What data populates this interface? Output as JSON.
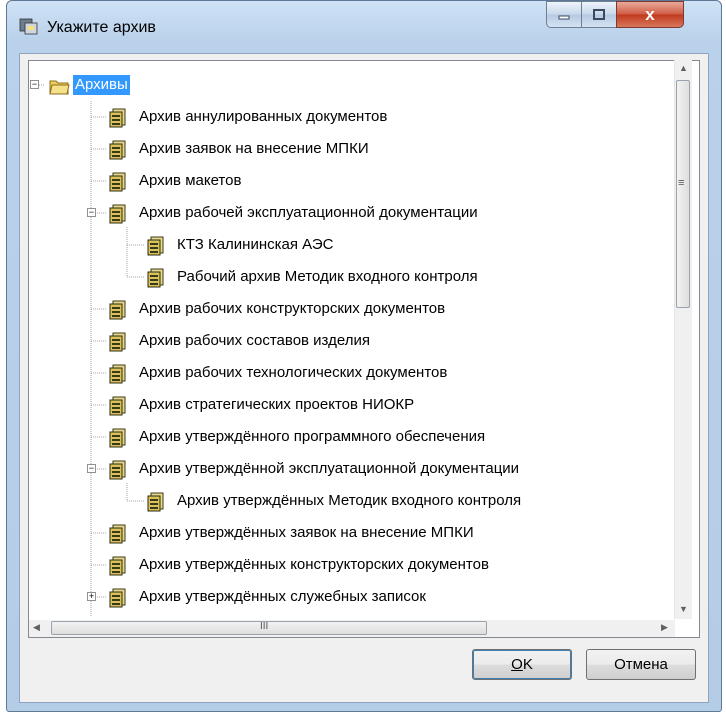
{
  "window": {
    "title": "Укажите архив",
    "close_glyph": "x",
    "colors": {
      "selection": "#3399ff",
      "title_gradient_top": "#cfe2f6",
      "close_red": "#c0391c"
    }
  },
  "tree": {
    "root": {
      "label": "Архивы",
      "icon": "folder-icon"
    },
    "items": [
      {
        "label": "Архив аннулированных документов"
      },
      {
        "label": "Архив заявок на внесение МПКИ"
      },
      {
        "label": "Архив макетов"
      },
      {
        "label": "Архив рабочей эксплуатационной документации"
      },
      {
        "label": "КТЗ Калининская АЭС"
      },
      {
        "label": "Рабочий архив Методик входного контроля"
      },
      {
        "label": "Архив рабочих конструкторских документов"
      },
      {
        "label": "Архив рабочих составов изделия"
      },
      {
        "label": "Архив рабочих технологических документов"
      },
      {
        "label": "Архив стратегических проектов НИОКР"
      },
      {
        "label": "Архив утверждённого программного обеспечения"
      },
      {
        "label": "Архив утверждённой эксплуатационной документации"
      },
      {
        "label": "Архив утверждённых Методик входного контроля"
      },
      {
        "label": "Архив утверждённых заявок на внесение МПКИ"
      },
      {
        "label": "Архив утверждённых конструкторских документов"
      },
      {
        "label": "Архив утверждённых служебных записок"
      }
    ]
  },
  "buttons": {
    "ok_mnemonic": "O",
    "ok_rest": "K",
    "cancel": "Отмена"
  },
  "scroll": {
    "h_thumb_glyph": "III",
    "v_thumb_glyph": "≡"
  }
}
